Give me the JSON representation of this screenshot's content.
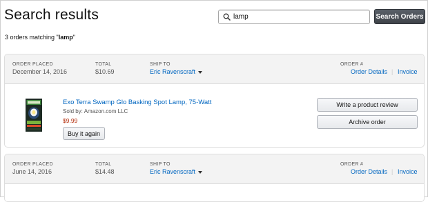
{
  "page": {
    "title": "Search results"
  },
  "search": {
    "value": "lamp",
    "button_label": "Search Orders"
  },
  "result_summary": {
    "prefix": "3 orders matching \"",
    "term": "lamp",
    "suffix": "\""
  },
  "orders": [
    {
      "order_placed_label": "ORDER PLACED",
      "order_placed_value": "December 14, 2016",
      "total_label": "TOTAL",
      "total_value": "$10.69",
      "ship_to_label": "SHIP TO",
      "ship_to_value": "Eric Ravenscraft",
      "order_number_label": "ORDER #",
      "order_details_label": "Order Details",
      "invoice_label": "Invoice",
      "item": {
        "title": "Exo Terra Swamp Glo Basking Spot Lamp, 75-Watt",
        "sold_by": "Sold by: Amazon.com LLC",
        "price": "$9.99",
        "buy_again_label": "Buy it again"
      },
      "actions": {
        "review_label": "Write a product review",
        "archive_label": "Archive order"
      }
    },
    {
      "order_placed_label": "ORDER PLACED",
      "order_placed_value": "June 14, 2016",
      "total_label": "TOTAL",
      "total_value": "$14.48",
      "ship_to_label": "SHIP TO",
      "ship_to_value": "Eric Ravenscraft",
      "order_number_label": "ORDER #",
      "order_details_label": "Order Details",
      "invoice_label": "Invoice"
    }
  ],
  "icons": {
    "search": "magnifier-icon",
    "caret": "caret-down-icon"
  },
  "colors": {
    "link": "#0066c0",
    "price": "#b12704",
    "header_bg": "#f3f3f3",
    "search_button": "#4a4f56"
  }
}
